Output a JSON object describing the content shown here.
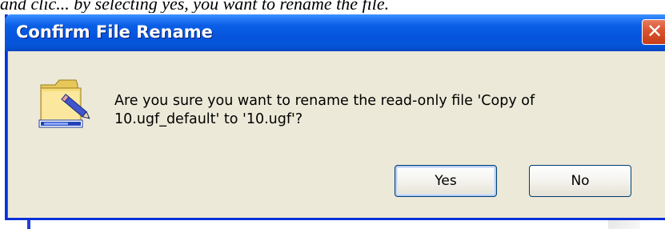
{
  "background": {
    "text_fragment": "and clic... by selecting yes, you want to rename the file."
  },
  "dialog": {
    "title": "Confirm File Rename",
    "close_glyph": "✕",
    "message": "Are you sure you want to rename the read-only file 'Copy of 10.ugf_default' to '10.ugf'?",
    "icon": "folder-rename-icon"
  },
  "buttons": {
    "yes_label": "Yes",
    "no_label": "No"
  },
  "colors": {
    "titlebar": "#0554d8",
    "dialog_bg": "#ece9d8",
    "close_button": "#d8532e",
    "button_border": "#003c74"
  }
}
